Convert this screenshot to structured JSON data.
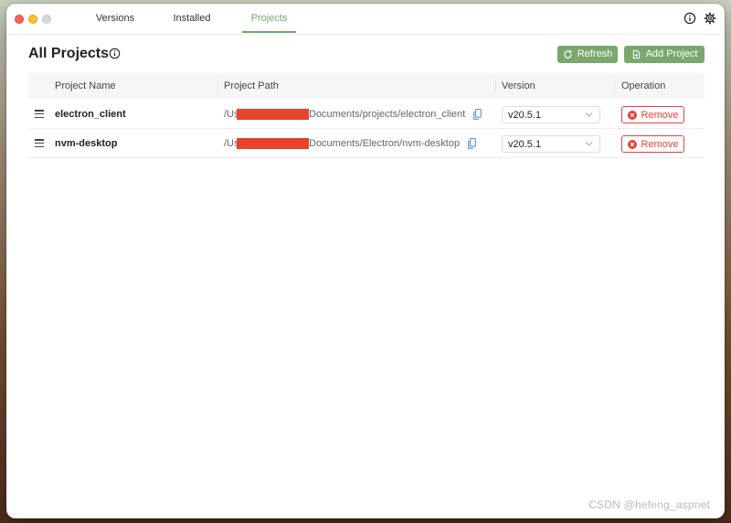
{
  "tabs": [
    {
      "label": "Versions",
      "active": false
    },
    {
      "label": "Installed",
      "active": false
    },
    {
      "label": "Projects",
      "active": true
    }
  ],
  "header_icons": [
    "info-icon",
    "gear-icon"
  ],
  "page": {
    "title": "All Projects"
  },
  "buttons": {
    "refresh": "Refresh",
    "add_project": "Add Project"
  },
  "table": {
    "columns": [
      "Project Name",
      "Project Path",
      "Version",
      "Operation"
    ],
    "rows": [
      {
        "name": "electron_client",
        "path_prefix": "/Us",
        "path_suffix": "Documents/projects/electron_client",
        "version": "v20.5.1",
        "operation": "Remove"
      },
      {
        "name": "nvm-desktop",
        "path_prefix": "/Us",
        "path_suffix": "Documents/Electron/nvm-desktop",
        "version": "v20.5.1",
        "operation": "Remove"
      }
    ]
  },
  "watermark": "CSDN @hefeng_aspnet",
  "colors": {
    "accent": "#7aa76e",
    "tab_active": "#6fa86a",
    "danger": "#e8413c",
    "redaction": "#e8432d"
  }
}
